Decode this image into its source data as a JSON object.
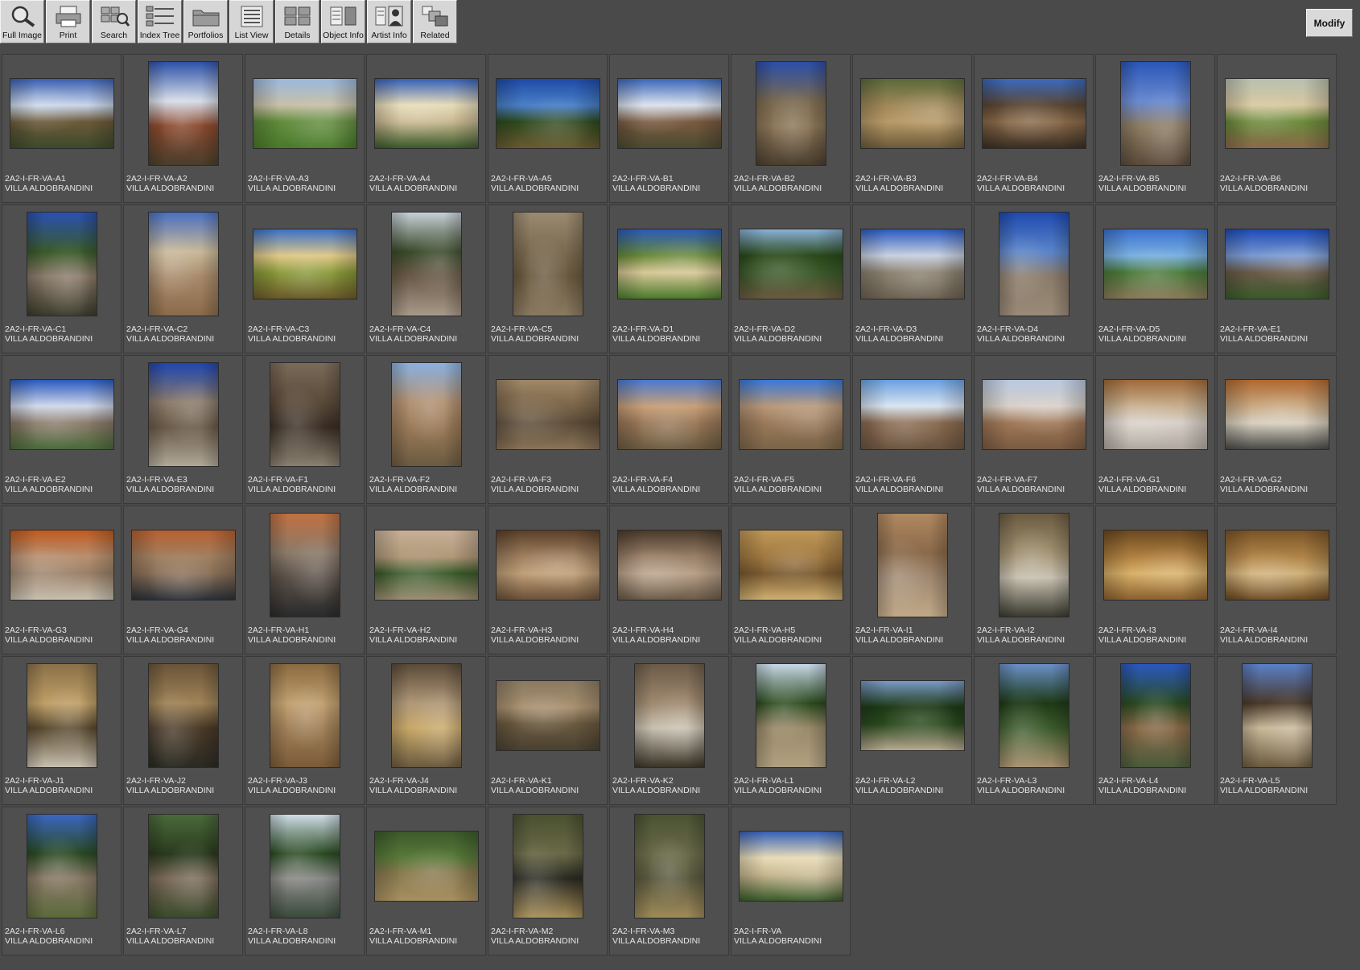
{
  "toolbar": {
    "items": [
      {
        "label": "Full Image",
        "icon": "magnifier-icon"
      },
      {
        "label": "Print",
        "icon": "printer-icon"
      },
      {
        "label": "Search",
        "icon": "search-grid-icon"
      },
      {
        "label": "Index Tree",
        "icon": "index-tree-icon"
      },
      {
        "label": "Portfolios",
        "icon": "folder-icon"
      },
      {
        "label": "List View",
        "icon": "list-view-icon"
      },
      {
        "label": "Details",
        "icon": "details-icon"
      },
      {
        "label": "Object Info",
        "icon": "object-info-icon"
      },
      {
        "label": "Artist  Info",
        "icon": "artist-info-icon"
      },
      {
        "label": "Related",
        "icon": "related-icon"
      }
    ]
  },
  "modify_label": "Modify",
  "collection": "VILLA ALDOBRANDINI",
  "thumbnails": [
    {
      "id": "2A2-I-FR-VA-A1",
      "orient": "land",
      "c": [
        "#3a5fb0",
        "#c9d6ea",
        "#6b5a3a",
        "#3d4a2a"
      ]
    },
    {
      "id": "2A2-I-FR-VA-A2",
      "orient": "port",
      "c": [
        "#2e52a8",
        "#d7dde8",
        "#8a4a2e",
        "#4a3d2c"
      ]
    },
    {
      "id": "2A2-I-FR-VA-A3",
      "orient": "land",
      "c": [
        "#9ab8dc",
        "#c8c0a8",
        "#5f8a3a",
        "#4a7a2a"
      ]
    },
    {
      "id": "2A2-I-FR-VA-A4",
      "orient": "land",
      "c": [
        "#3560b8",
        "#e8dcb8",
        "#c8b890",
        "#3a5a2a"
      ]
    },
    {
      "id": "2A2-I-FR-VA-A5",
      "orient": "land",
      "c": [
        "#1e4aa8",
        "#4a80c8",
        "#2e4a1e",
        "#6a5a30"
      ]
    },
    {
      "id": "2A2-I-FR-VA-B1",
      "orient": "land",
      "c": [
        "#3a66b8",
        "#d8e0ec",
        "#7a5a40",
        "#4a4a30"
      ]
    },
    {
      "id": "2A2-I-FR-VA-B2",
      "orient": "port",
      "c": [
        "#2a4ea8",
        "#7a6a50",
        "#8a7456",
        "#4a3e2e"
      ]
    },
    {
      "id": "2A2-I-FR-VA-B3",
      "orient": "land",
      "c": [
        "#5a6a3a",
        "#a08858",
        "#b89a68",
        "#6a5a3a"
      ]
    },
    {
      "id": "2A2-I-FR-VA-B4",
      "orient": "land",
      "c": [
        "#3a6ac0",
        "#5a4632",
        "#8a6a4a",
        "#3a2e22"
      ]
    },
    {
      "id": "2A2-I-FR-VA-B5",
      "orient": "port",
      "c": [
        "#2a56b8",
        "#6a8ad0",
        "#8a7a60",
        "#5a4a3a"
      ]
    },
    {
      "id": "2A2-I-FR-VA-B6",
      "orient": "land",
      "c": [
        "#b8c0b0",
        "#d8c8a0",
        "#6a8a3a",
        "#8a6a4a"
      ]
    },
    {
      "id": "2A2-I-FR-VA-C1",
      "orient": "port",
      "c": [
        "#2a50b0",
        "#3a5a2a",
        "#8a7a6a",
        "#3a3a2a"
      ]
    },
    {
      "id": "2A2-I-FR-VA-C2",
      "orient": "port",
      "c": [
        "#4a70c0",
        "#c8b898",
        "#a88a6a",
        "#8a6a4a"
      ]
    },
    {
      "id": "2A2-I-FR-VA-C3",
      "orient": "land",
      "c": [
        "#3a70c8",
        "#e0c888",
        "#8a9a3a",
        "#6a5a2a"
      ]
    },
    {
      "id": "2A2-I-FR-VA-C4",
      "orient": "port",
      "c": [
        "#c8d0d8",
        "#3a4a2a",
        "#6a5a48",
        "#a89a8a"
      ]
    },
    {
      "id": "2A2-I-FR-VA-C5",
      "orient": "port",
      "c": [
        "#9a8a70",
        "#7a6a50",
        "#6a5a40",
        "#8a7a60"
      ]
    },
    {
      "id": "2A2-I-FR-VA-D1",
      "orient": "land",
      "c": [
        "#2a5ab8",
        "#6a8a3a",
        "#d8c898",
        "#4a7a2a"
      ]
    },
    {
      "id": "2A2-I-FR-VA-D2",
      "orient": "land",
      "c": [
        "#8ab0d8",
        "#2a4a1a",
        "#3a5a2a",
        "#6a5a40"
      ]
    },
    {
      "id": "2A2-I-FR-VA-D3",
      "orient": "land",
      "c": [
        "#2a5ac0",
        "#c8d0e0",
        "#8a8070",
        "#6a6050"
      ]
    },
    {
      "id": "2A2-I-FR-VA-D4",
      "orient": "port",
      "c": [
        "#1e4ab0",
        "#5a84c8",
        "#8a7a68",
        "#9a8a78"
      ]
    },
    {
      "id": "2A2-I-FR-VA-D5",
      "orient": "land",
      "c": [
        "#3a70d0",
        "#7ab0e0",
        "#4a7a3a",
        "#8a7a5a"
      ]
    },
    {
      "id": "2A2-I-FR-VA-E1",
      "orient": "land",
      "c": [
        "#1e4ab8",
        "#7a9ad0",
        "#6a5a48",
        "#3a5a2a"
      ]
    },
    {
      "id": "2A2-I-FR-VA-E2",
      "orient": "land",
      "c": [
        "#2a5ac0",
        "#d0d8e8",
        "#8a7a6a",
        "#4a6a3a"
      ]
    },
    {
      "id": "2A2-I-FR-VA-E3",
      "orient": "port",
      "c": [
        "#1e46b0",
        "#8a7a6a",
        "#6a5a48",
        "#b0a898"
      ]
    },
    {
      "id": "2A2-I-FR-VA-F1",
      "orient": "port",
      "c": [
        "#7a6a58",
        "#5a4a3a",
        "#3a2e24",
        "#8a8070"
      ]
    },
    {
      "id": "2A2-I-FR-VA-F2",
      "orient": "port",
      "c": [
        "#8ab0e0",
        "#b09070",
        "#9a7a58",
        "#6a5a40"
      ]
    },
    {
      "id": "2A2-I-FR-VA-F3",
      "orient": "land",
      "c": [
        "#a08868",
        "#7a6448",
        "#5a4a36",
        "#8a7458"
      ]
    },
    {
      "id": "2A2-I-FR-VA-F4",
      "orient": "land",
      "c": [
        "#4a7ad0",
        "#c8a078",
        "#9a7858",
        "#6a5a40"
      ]
    },
    {
      "id": "2A2-I-FR-VA-F5",
      "orient": "land",
      "c": [
        "#3a78d8",
        "#b89878",
        "#9a7a5a",
        "#7a6448"
      ]
    },
    {
      "id": "2A2-I-FR-VA-F6",
      "orient": "land",
      "c": [
        "#6aa0e0",
        "#d8e4f0",
        "#8a6a50",
        "#6a5440"
      ]
    },
    {
      "id": "2A2-I-FR-VA-F7",
      "orient": "land",
      "c": [
        "#b8c8e0",
        "#d8d0c8",
        "#a07858",
        "#7a5a40"
      ]
    },
    {
      "id": "2A2-I-FR-VA-G1",
      "orient": "land",
      "c": [
        "#a06a3a",
        "#c8b090",
        "#d8d0c8",
        "#b0a8a0"
      ]
    },
    {
      "id": "2A2-I-FR-VA-G2",
      "orient": "land",
      "c": [
        "#b06830",
        "#c8a880",
        "#d8d0c0",
        "#4a4a48"
      ]
    },
    {
      "id": "2A2-I-FR-VA-G3",
      "orient": "land",
      "c": [
        "#c05a20",
        "#b89070",
        "#9a8068",
        "#c8c0b0"
      ]
    },
    {
      "id": "2A2-I-FR-VA-G4",
      "orient": "land",
      "c": [
        "#b86030",
        "#a08060",
        "#8a7058",
        "#2a3038"
      ]
    },
    {
      "id": "2A2-I-FR-VA-H1",
      "orient": "port",
      "c": [
        "#c07040",
        "#8a7a6a",
        "#5a5048",
        "#2a2a2a"
      ]
    },
    {
      "id": "2A2-I-FR-VA-H2",
      "orient": "land",
      "c": [
        "#c8b098",
        "#b09878",
        "#3a5a2a",
        "#9a8a70"
      ]
    },
    {
      "id": "2A2-I-FR-VA-H3",
      "orient": "land",
      "c": [
        "#5a4028",
        "#a08060",
        "#c0a078",
        "#6a5038"
      ]
    },
    {
      "id": "2A2-I-FR-VA-H4",
      "orient": "land",
      "c": [
        "#4a3a2a",
        "#9a8068",
        "#b8a088",
        "#6a5a48"
      ]
    },
    {
      "id": "2A2-I-FR-VA-H5",
      "orient": "land",
      "c": [
        "#c09858",
        "#a07840",
        "#7a5a30",
        "#d0b070"
      ]
    },
    {
      "id": "2A2-I-FR-VA-I1",
      "orient": "port",
      "c": [
        "#b08860",
        "#8a6a4a",
        "#a08870",
        "#c0a888"
      ]
    },
    {
      "id": "2A2-I-FR-VA-I2",
      "orient": "port",
      "c": [
        "#6a5a40",
        "#a09070",
        "#c8c0b0",
        "#3a3a30"
      ]
    },
    {
      "id": "2A2-I-FR-VA-I3",
      "orient": "land",
      "c": [
        "#6a4820",
        "#b08040",
        "#d8b068",
        "#8a6030"
      ]
    },
    {
      "id": "2A2-I-FR-VA-I4",
      "orient": "land",
      "c": [
        "#7a5428",
        "#b08448",
        "#d0b078",
        "#6a4820"
      ]
    },
    {
      "id": "2A2-I-FR-VA-J1",
      "orient": "port",
      "c": [
        "#8a7048",
        "#c0a068",
        "#5a4a30",
        "#c8c0b0"
      ]
    },
    {
      "id": "2A2-I-FR-VA-J2",
      "orient": "port",
      "c": [
        "#6a5438",
        "#a08458",
        "#4a3a28",
        "#2a2a22"
      ]
    },
    {
      "id": "2A2-I-FR-VA-J3",
      "orient": "port",
      "c": [
        "#8a6a40",
        "#c0a070",
        "#a08058",
        "#7a5a38"
      ]
    },
    {
      "id": "2A2-I-FR-VA-J4",
      "orient": "port",
      "c": [
        "#5a4a38",
        "#b09878",
        "#c8a868",
        "#6a5a40"
      ]
    },
    {
      "id": "2A2-I-FR-VA-K1",
      "orient": "land",
      "c": [
        "#8a7a60",
        "#a89070",
        "#6a5a40",
        "#4a4030"
      ]
    },
    {
      "id": "2A2-I-FR-VA-K2",
      "orient": "port",
      "c": [
        "#6a5a48",
        "#a08a70",
        "#c8c0b0",
        "#3a3428"
      ]
    },
    {
      "id": "2A2-I-FR-VA-L1",
      "orient": "port",
      "c": [
        "#c8d8e8",
        "#2a4a1e",
        "#9a8a6a",
        "#b0a080"
      ]
    },
    {
      "id": "2A2-I-FR-VA-L2",
      "orient": "land",
      "c": [
        "#7a9ac8",
        "#1e3a16",
        "#2a4a1e",
        "#b8a890"
      ]
    },
    {
      "id": "2A2-I-FR-VA-L3",
      "orient": "port",
      "c": [
        "#6a90c8",
        "#1e3a16",
        "#3a5a2a",
        "#a89070"
      ]
    },
    {
      "id": "2A2-I-FR-VA-L4",
      "orient": "port",
      "c": [
        "#2a58c0",
        "#2a4a22",
        "#8a6a48",
        "#4a5a3a"
      ]
    },
    {
      "id": "2A2-I-FR-VA-L5",
      "orient": "port",
      "c": [
        "#5a80c8",
        "#4a3a2a",
        "#c8b898",
        "#6a5a40"
      ]
    },
    {
      "id": "2A2-I-FR-VA-L6",
      "orient": "port",
      "c": [
        "#3a66c0",
        "#2a4a22",
        "#8a7a68",
        "#5a6a3a"
      ]
    },
    {
      "id": "2A2-I-FR-VA-L7",
      "orient": "port",
      "c": [
        "#4a6a3a",
        "#2a3a1e",
        "#7a6a58",
        "#3a4a2a"
      ]
    },
    {
      "id": "2A2-I-FR-VA-L8",
      "orient": "port",
      "c": [
        "#d0dde8",
        "#2a4a22",
        "#8a8a88",
        "#3a4a3a"
      ]
    },
    {
      "id": "2A2-I-FR-VA-M1",
      "orient": "land",
      "c": [
        "#3a5a2a",
        "#5a7a3a",
        "#8a7a50",
        "#a89060"
      ]
    },
    {
      "id": "2A2-I-FR-VA-M2",
      "orient": "port",
      "c": [
        "#4a5030",
        "#6a6a48",
        "#2a2a22",
        "#a89058"
      ]
    },
    {
      "id": "2A2-I-FR-VA-M3",
      "orient": "port",
      "c": [
        "#4a5232",
        "#6a6a4a",
        "#5a5a40",
        "#a08a58"
      ]
    },
    {
      "id": "2A2-I-FR-VA",
      "orient": "land",
      "c": [
        "#3560b8",
        "#e8dcb8",
        "#c8b890",
        "#3a5a2a"
      ]
    }
  ]
}
